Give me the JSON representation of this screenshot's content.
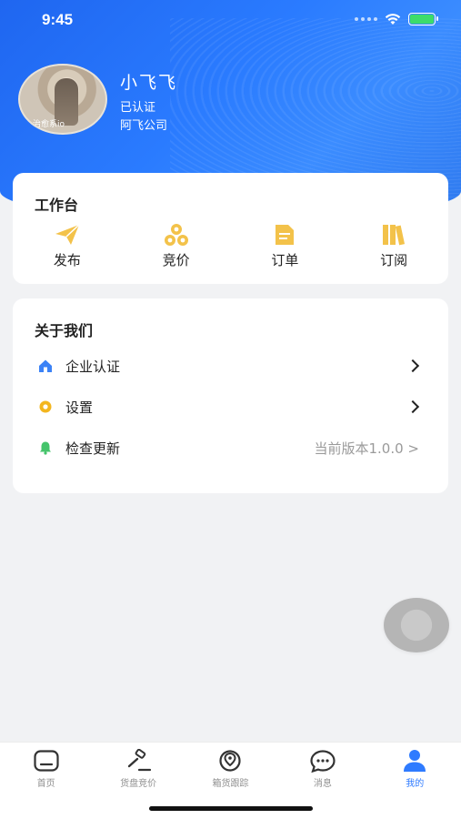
{
  "status_bar": {
    "time": "9:45"
  },
  "profile": {
    "name": "小飞飞",
    "verified_text": "已认证",
    "company": "阿飞公司",
    "avatar_watermark": "治愈系io"
  },
  "workbench": {
    "title": "工作台",
    "items": [
      {
        "label": "发布",
        "icon": "paper-plane-icon"
      },
      {
        "label": "竞价",
        "icon": "coins-icon"
      },
      {
        "label": "订单",
        "icon": "document-icon"
      },
      {
        "label": "订阅",
        "icon": "books-icon"
      }
    ]
  },
  "about": {
    "title": "关于我们",
    "items": [
      {
        "label": "企业认证",
        "icon": "house-icon",
        "icon_color": "#3b82f6"
      },
      {
        "label": "设置",
        "icon": "gear-icon",
        "icon_color": "#f3b61f"
      },
      {
        "label": "检查更新",
        "icon": "bell-icon",
        "icon_color": "#45c46b",
        "value": "当前版本1.0.0 >"
      }
    ]
  },
  "tabbar": {
    "items": [
      {
        "label": "首页",
        "icon": "home-icon",
        "active": false
      },
      {
        "label": "货盘竞价",
        "icon": "gavel-icon",
        "active": false
      },
      {
        "label": "箱货跟踪",
        "icon": "map-pin-icon",
        "active": false
      },
      {
        "label": "消息",
        "icon": "chat-icon",
        "active": false
      },
      {
        "label": "我的",
        "icon": "user-icon",
        "active": true
      }
    ]
  },
  "colors": {
    "primary": "#2f7bff",
    "workbench_icon": "#f3c24a",
    "background": "#f1f2f4"
  }
}
